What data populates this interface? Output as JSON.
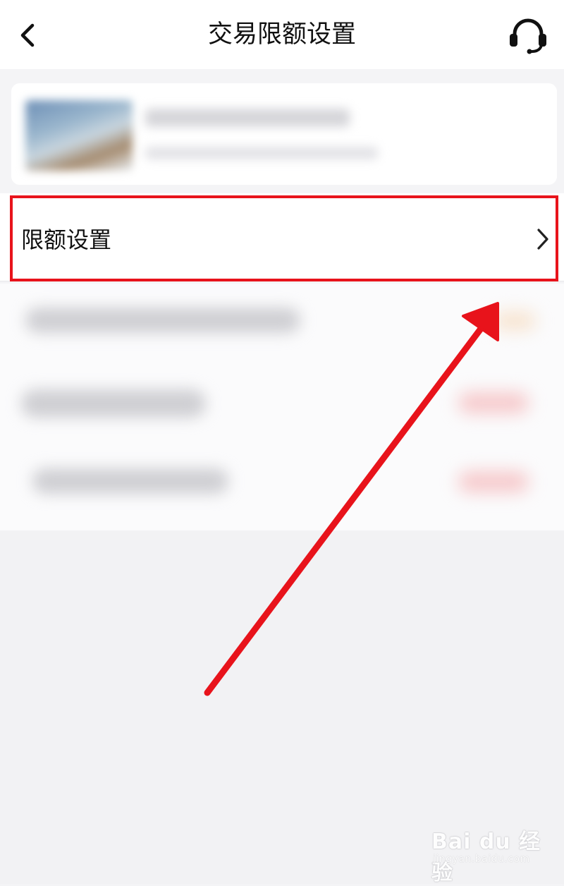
{
  "header": {
    "title": "交易限额设置",
    "back_icon": "chevron-left-icon",
    "support_icon": "headset-icon"
  },
  "limit_row": {
    "label": "限额设置",
    "chevron_icon": "chevron-right-icon"
  },
  "annotation": {
    "highlight_color": "#e8131b",
    "arrow_color": "#e8131b"
  },
  "watermark": {
    "brand": "Bai du 经验",
    "sub": "jingyan.baidu.com"
  }
}
